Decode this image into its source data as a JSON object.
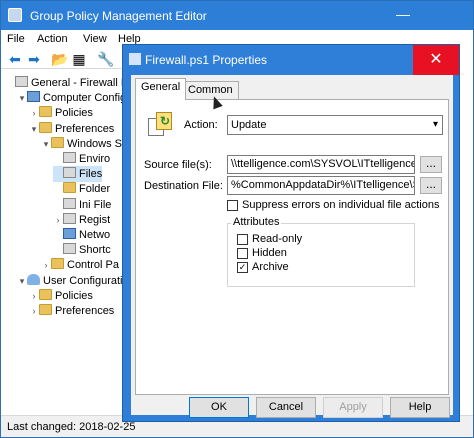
{
  "outer": {
    "title": "Group Policy Management Editor",
    "minimize_glyph": "—",
    "menu": [
      "File",
      "Action",
      "View",
      "Help"
    ],
    "toolbar_icons": [
      "back-arrow-icon",
      "forward-arrow-icon",
      "up-folder-icon",
      "show-hide-tree-icon",
      "wrench-icon"
    ],
    "toolbar_glyphs": [
      "⬅",
      "➡",
      "📂",
      "▦",
      "🔧"
    ],
    "tree": [
      {
        "label": "General - Firewall Rul",
        "level": 0,
        "icon": "policy-icon",
        "expander": ""
      },
      {
        "label": "Computer Configu",
        "level": 1,
        "icon": "computer-icon",
        "expander": "▾"
      },
      {
        "label": "Policies",
        "level": 2,
        "icon": "folder-icon",
        "expander": "›"
      },
      {
        "label": "Preferences",
        "level": 2,
        "icon": "folder-icon",
        "expander": "▾"
      },
      {
        "label": "Windows S",
        "level": 3,
        "icon": "folder-icon",
        "expander": "▾"
      },
      {
        "label": "Enviro",
        "level": 4,
        "icon": "environment-icon",
        "expander": ""
      },
      {
        "label": "Files",
        "level": 4,
        "icon": "files-icon",
        "expander": "",
        "selected": true
      },
      {
        "label": "Folder",
        "level": 4,
        "icon": "folder-icon",
        "expander": ""
      },
      {
        "label": "Ini File",
        "level": 4,
        "icon": "ini-file-icon",
        "expander": ""
      },
      {
        "label": "Regist",
        "level": 4,
        "icon": "registry-icon",
        "expander": "›"
      },
      {
        "label": "Netwo",
        "level": 4,
        "icon": "network-icon",
        "expander": ""
      },
      {
        "label": "Shortc",
        "level": 4,
        "icon": "shortcut-icon",
        "expander": ""
      },
      {
        "label": "Control Pa",
        "level": 3,
        "icon": "folder-icon",
        "expander": "›"
      },
      {
        "label": "User Configuratio",
        "level": 1,
        "icon": "user-icon",
        "expander": "▾"
      },
      {
        "label": "Policies",
        "level": 2,
        "icon": "folder-icon",
        "expander": "›"
      },
      {
        "label": "Preferences",
        "level": 2,
        "icon": "folder-icon",
        "expander": "›"
      }
    ],
    "status": "Last changed: 2018-02-25"
  },
  "dialog": {
    "title": "Firewall.ps1 Properties",
    "close_glyph": "✕",
    "tabs": [
      "General",
      "Common"
    ],
    "action_label": "Action:",
    "action_value": "Update",
    "source_label": "Source file(s):",
    "source_value": "\\\\ttelligence.com\\SYSVOL\\ITtelligence.com\\sc",
    "destination_label": "Destination File:",
    "destination_value": "%CommonAppdataDir%\\ITtelligence\\Scripts\\",
    "browse_label": "...",
    "suppress_label": "Suppress errors on individual file actions",
    "suppress_checked": false,
    "attributes_title": "Attributes",
    "attributes": [
      {
        "label": "Read-only",
        "checked": false
      },
      {
        "label": "Hidden",
        "checked": false
      },
      {
        "label": "Archive",
        "checked": true
      }
    ],
    "buttons": {
      "ok": "OK",
      "cancel": "Cancel",
      "apply": "Apply",
      "help": "Help"
    },
    "check_glyph": "✓",
    "caret_glyph": "▾"
  }
}
